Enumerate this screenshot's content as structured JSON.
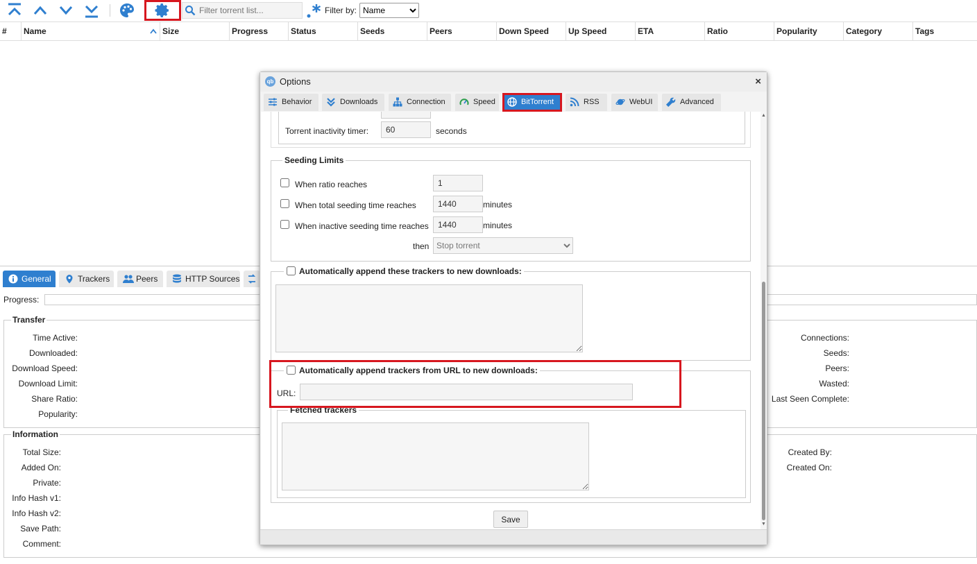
{
  "toolbar": {
    "search_placeholder": "Filter torrent list...",
    "filter_label": "Filter by:",
    "filter_value": "Name"
  },
  "table": {
    "columns": [
      "#",
      "Name",
      "Size",
      "Progress",
      "Status",
      "Seeds",
      "Peers",
      "Down Speed",
      "Up Speed",
      "ETA",
      "Ratio",
      "Popularity",
      "Category",
      "Tags"
    ]
  },
  "props": {
    "tabs": [
      "General",
      "Trackers",
      "Peers",
      "HTTP Sources"
    ],
    "progress_label": "Progress:",
    "transfer": {
      "legend": "Transfer",
      "left": [
        "Time Active:",
        "Downloaded:",
        "Download Speed:",
        "Download Limit:",
        "Share Ratio:",
        "Popularity:"
      ],
      "right": [
        "Connections:",
        "Seeds:",
        "Peers:",
        "Wasted:",
        "Last Seen Complete:"
      ]
    },
    "information": {
      "legend": "Information",
      "left": [
        "Total Size:",
        "Added On:",
        "Private:",
        "Info Hash v1:",
        "Info Hash v2:",
        "Save Path:",
        "Comment:"
      ],
      "right": [
        "Created By:",
        "Created On:"
      ]
    }
  },
  "dialog": {
    "title": "Options",
    "close": "×",
    "tabs": [
      "Behavior",
      "Downloads",
      "Connection",
      "Speed",
      "BitTorrent",
      "RSS",
      "WebUI",
      "Advanced"
    ],
    "active_tab": "BitTorrent",
    "inactivity": {
      "label": "Torrent inactivity timer:",
      "value": "60",
      "unit": "seconds"
    },
    "seeding": {
      "legend": "Seeding Limits",
      "ratio_label": "When ratio reaches",
      "ratio_value": "1",
      "total_label": "When total seeding time reaches",
      "total_value": "1440",
      "total_unit": "minutes",
      "inactive_label": "When inactive seeding time reaches",
      "inactive_value": "1440",
      "inactive_unit": "minutes",
      "then_label": "then",
      "action": "Stop torrent"
    },
    "append_trackers": {
      "legend": "Automatically append these trackers to new downloads:"
    },
    "append_url": {
      "legend": "Automatically append trackers from URL to new downloads:",
      "url_label": "URL:",
      "fetched_legend": "Fetched trackers"
    },
    "save_label": "Save"
  },
  "colors": {
    "accent": "#2f7fcf",
    "highlight": "#d7171f"
  }
}
